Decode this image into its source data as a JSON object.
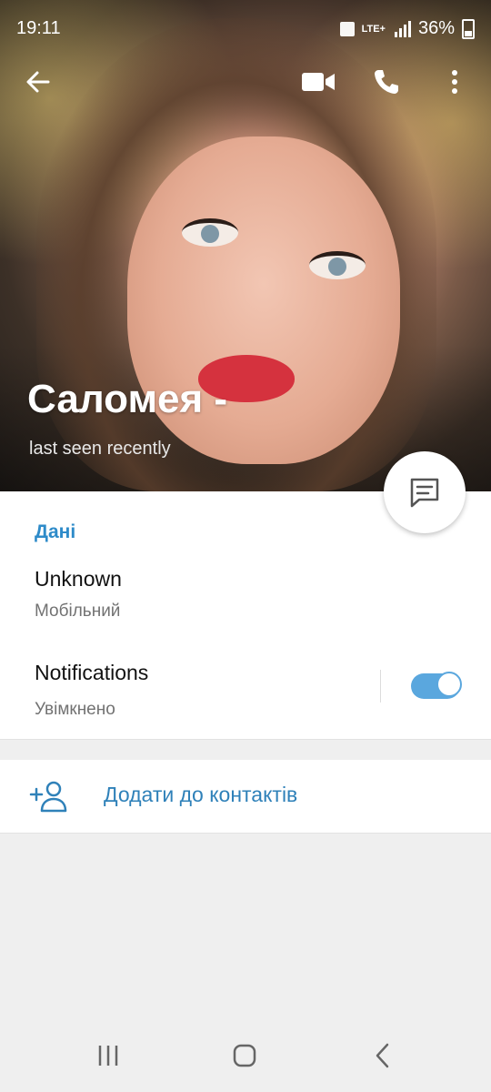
{
  "status_bar": {
    "time": "19:11",
    "network": "LTE+",
    "battery": "36%"
  },
  "profile": {
    "name": "Саломея -",
    "last_seen": "last seen recently"
  },
  "info": {
    "section_title": "Дані",
    "phone_value": "Unknown",
    "phone_type": "Мобільний",
    "notifications_label": "Notifications",
    "notifications_status": "Увімкнено",
    "notifications_enabled": true
  },
  "actions": {
    "add_to_contacts": "Додати до контактів"
  },
  "colors": {
    "accent": "#2e8bc9",
    "toggle": "#5aa7de",
    "background": "#efefef"
  },
  "icons": {
    "back": "arrow-left-icon",
    "video": "video-call-icon",
    "call": "phone-icon",
    "menu": "more-vert-icon",
    "message": "message-icon",
    "add_contact": "add-person-icon"
  }
}
